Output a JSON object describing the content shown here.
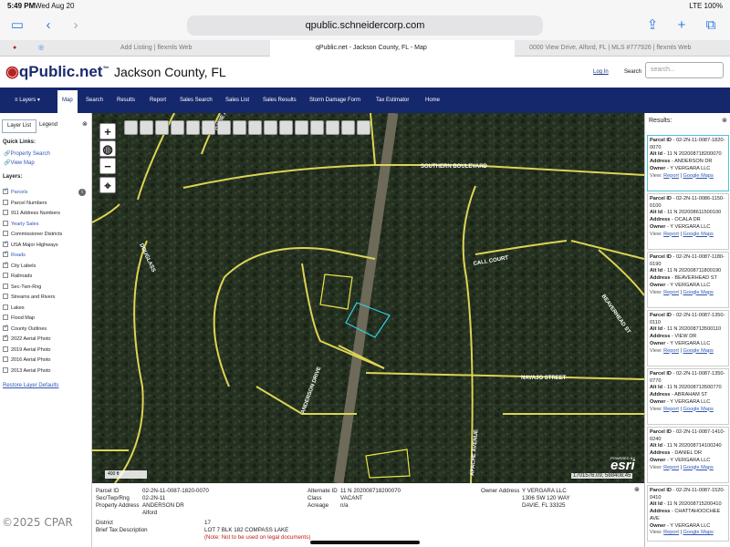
{
  "status": {
    "time": "5:49 PM",
    "date": "Wed Aug 20",
    "right": "LTE 100%"
  },
  "browser": {
    "url": "qpublic.schneidercorp.com",
    "tabs": [
      {
        "label": "Add Listing | flexmls Web"
      },
      {
        "label": "qPublic.net - Jackson County, FL - Map"
      },
      {
        "label": "0000 View Drive, Alford, FL | MLS #777926 | flexmls Web"
      }
    ]
  },
  "site": {
    "logo": "qPublic.net",
    "trademark": "™",
    "county": "Jackson County, FL",
    "login": "Log In",
    "search_label": "Search",
    "search_placeholder": "search..."
  },
  "nav": [
    "Layers",
    "Map",
    "Search",
    "Results",
    "Report",
    "Sales Search",
    "Sales List",
    "Sales Results",
    "Storm Damage Form",
    "Tax Estimator",
    "Home"
  ],
  "left": {
    "tab_layer": "Layer List",
    "tab_legend": "Legend",
    "quick_links_title": "Quick Links:",
    "quick_links": [
      "Property Search",
      "View Map"
    ],
    "layers_title": "Layers:",
    "layers": [
      {
        "label": "Parcels",
        "checked": true,
        "blue": true
      },
      {
        "label": "Parcel Numbers",
        "checked": false,
        "blue": false
      },
      {
        "label": "911 Address Numbers",
        "checked": false,
        "blue": false
      },
      {
        "label": "Yearly Sales",
        "checked": false,
        "blue": true
      },
      {
        "label": "Commissioner Districts",
        "checked": false,
        "blue": false
      },
      {
        "label": "USA Major Highways",
        "checked": true,
        "blue": false
      },
      {
        "label": "Roads",
        "checked": true,
        "blue": true
      },
      {
        "label": "City Labels",
        "checked": true,
        "blue": false
      },
      {
        "label": "Railroads",
        "checked": false,
        "blue": false
      },
      {
        "label": "Sec-Twn-Rng",
        "checked": false,
        "blue": false
      },
      {
        "label": "Streams and Rivers",
        "checked": false,
        "blue": false
      },
      {
        "label": "Lakes",
        "checked": false,
        "blue": false
      },
      {
        "label": "Flood Map",
        "checked": false,
        "blue": false
      },
      {
        "label": "County Outlines",
        "checked": true,
        "blue": false
      },
      {
        "label": "2022 Aerial Photo",
        "checked": true,
        "blue": false
      },
      {
        "label": "2019 Aerial Photo",
        "checked": false,
        "blue": false
      },
      {
        "label": "2016 Aerial Photo",
        "checked": false,
        "blue": false
      },
      {
        "label": "2013 Aerial Photo",
        "checked": false,
        "blue": false
      }
    ],
    "restore": "Restore Layer Defaults"
  },
  "map": {
    "street_labels": [
      "SOUTHERN BOULEVARD",
      "BEAVERHEAD ST",
      "NAVAJO STREET",
      "CALL COURT",
      "APACHE AVENUE",
      "ANDERSON DRIVE",
      "DAVIE AVE",
      "DOUGLASS"
    ],
    "scale": "400 ft",
    "coords": "1701576.09, 588408.45",
    "esri": "esri",
    "powered_by": "POWERED BY"
  },
  "results": {
    "title": "Results:",
    "items": [
      {
        "parcel": "02-2N-11-0087-1820-0070",
        "alt": "11 N 202008718200070",
        "address": "ANDERSON DR",
        "owner": "Y VERGARA LLC"
      },
      {
        "parcel": "02-2N-11-0086-1150-0100",
        "alt": "11 N 202008611500100",
        "address": "OCALA DR",
        "owner": "Y VERGARA LLC"
      },
      {
        "parcel": "02-2N-11-0087-1180-0190",
        "alt": "11 N 202008711800190",
        "address": "BEAVERHEAD ST",
        "owner": "Y VERGARA LLC"
      },
      {
        "parcel": "02-2N-11-0087-1350-0110",
        "alt": "11 N 202008713500110",
        "address": "VIEW DR",
        "owner": "Y VERGARA LLC"
      },
      {
        "parcel": "02-2N-11-0087-1350-0770",
        "alt": "11 N 202008713500770",
        "address": "ABRAHAM ST",
        "owner": "Y VERGARA LLC"
      },
      {
        "parcel": "02-2N-11-0087-1410-0240",
        "alt": "11 N 202008714100240",
        "address": "DANIEL DR",
        "owner": "Y VERGARA LLC"
      },
      {
        "parcel": "02-2N-11-0087-1520-0410",
        "alt": "11 N 202008715200410",
        "address": "CHATTAHOOCHEE AVE",
        "owner": "Y VERGARA LLC"
      }
    ],
    "labels": {
      "parcel": "Parcel ID",
      "alt": "Alt Id",
      "address": "Address",
      "owner": "Owner",
      "view": "View:",
      "report": "Report",
      "gmaps": "Google Maps"
    }
  },
  "detail": {
    "parcel_label": "Parcel ID",
    "parcel": "02-2N-11-0087-1820-0070",
    "str_label": "Sec/Twp/Rng",
    "str": "02-2N-11",
    "addr_label": "Property Address",
    "addr": "ANDERSON DR",
    "city": "Alford",
    "district_label": "District",
    "district": "17",
    "brief_label": "Brief Tax Description",
    "brief": "LOT 7 BLK 182 COMPASS LAKE",
    "note": "(Note: Not to be used on legal documents)",
    "alt_label": "Alternate ID",
    "alt": "11 N 202008718200070",
    "class_label": "Class",
    "class": "VACANT",
    "acreage_label": "Acreage",
    "acreage": "n/a",
    "owner_label": "Owner Address",
    "owner1": "Y VERGARA LLC",
    "owner2": "1306 SW 120 WAY",
    "owner3": "DAVIE, FL 33325"
  },
  "watermark": "©2025 CPAR"
}
